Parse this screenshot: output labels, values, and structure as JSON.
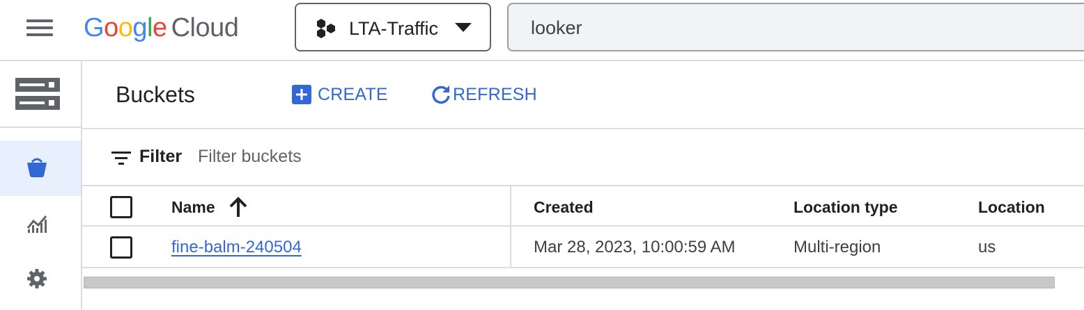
{
  "header": {
    "logo": {
      "google_letters": [
        "G",
        "o",
        "o",
        "g",
        "l",
        "e"
      ],
      "cloud": "Cloud"
    },
    "project": {
      "name": "LTA-Traffic"
    },
    "search": {
      "value": "looker"
    }
  },
  "page": {
    "title": "Buckets",
    "create_label": "CREATE",
    "refresh_label": "REFRESH"
  },
  "filter": {
    "label": "Filter",
    "placeholder": "Filter buckets"
  },
  "table": {
    "columns": [
      "Name",
      "Created",
      "Location type",
      "Location"
    ],
    "sort": {
      "column": "Name",
      "direction": "ascending"
    },
    "rows": [
      {
        "name": "fine-balm-240504",
        "created": "Mar 28, 2023, 10:00:59 AM",
        "location_type": "Multi-region",
        "location": "us"
      }
    ]
  },
  "colors": {
    "accent": "#3367d6",
    "google_blue": "#4285f4",
    "google_red": "#ea4335",
    "google_yellow": "#fbbc04",
    "google_green": "#34a853",
    "active_rail": "#e8f0fe"
  },
  "icons": [
    "menu-icon",
    "project-hex-icon",
    "dropdown-caret-icon",
    "storage-server-icon",
    "bucket-icon",
    "chart-icon",
    "gear-icon",
    "add-box-icon",
    "refresh-icon",
    "filter-icon",
    "arrow-up-icon"
  ]
}
